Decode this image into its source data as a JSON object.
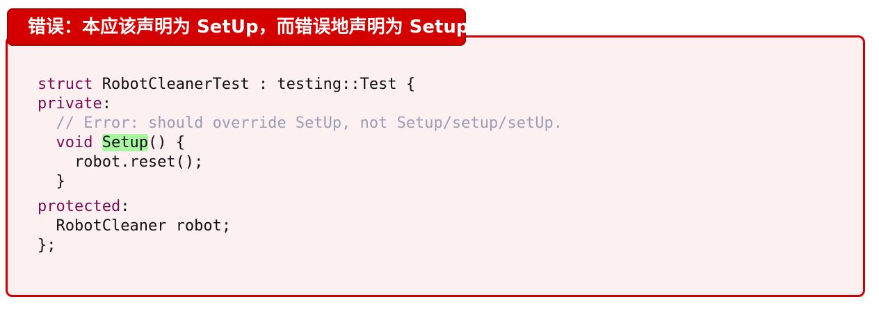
{
  "header": {
    "title": "错误：本应该声明为 SetUp，而错误地声明为 Setup"
  },
  "code": {
    "line1": {
      "kw": "struct",
      "rest": " RobotCleanerTest : testing::Test {"
    },
    "line2": {
      "kw": "private",
      "rest": ":"
    },
    "line3": {
      "indent": "  ",
      "comment": "// Error: should override SetUp, not Setup/setup/setUp."
    },
    "line4": {
      "indent": "  ",
      "kw": "void",
      "sp": " ",
      "highlight": "Setup",
      "rest": "() {"
    },
    "line5": {
      "text": "    robot.reset();"
    },
    "line6": {
      "text": "  }"
    },
    "line7": {
      "kw": "protected",
      "rest": ":"
    },
    "line8": {
      "text": "  RobotCleaner robot;"
    },
    "line9": {
      "text": "};"
    }
  },
  "colors": {
    "header_bg": "#d40000",
    "border": "#cc0000",
    "box_bg": "#fdf0f0",
    "keyword": "#7a0c52",
    "comment": "#9c9cb4",
    "highlight": "#a8f5a2"
  }
}
